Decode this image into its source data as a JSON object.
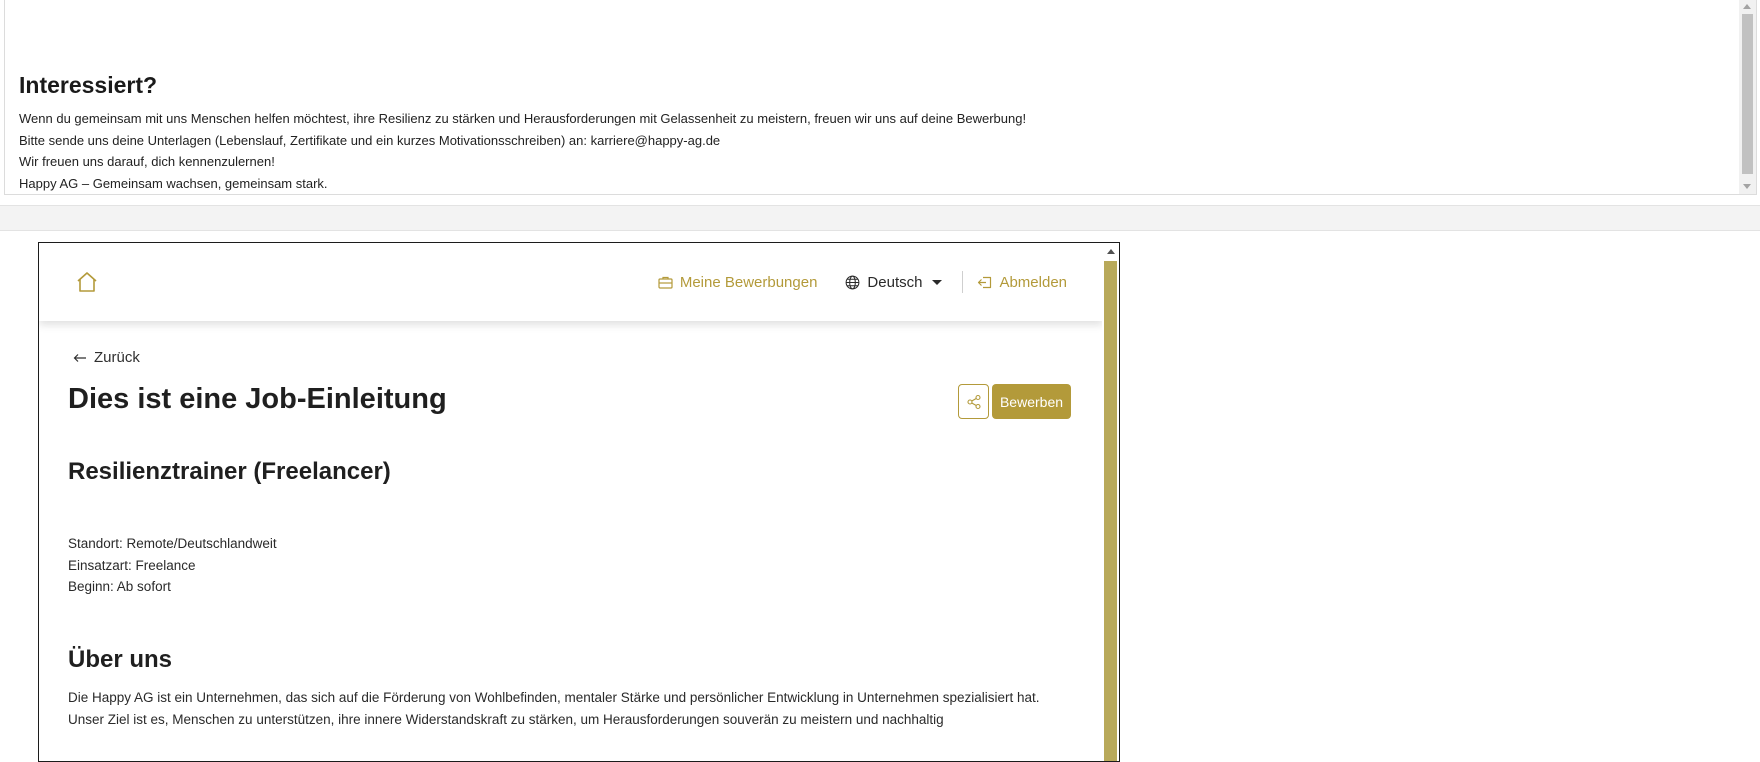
{
  "top": {
    "heading": "Interessiert?",
    "lines": [
      "Wenn du gemeinsam mit uns Menschen helfen möchtest, ihre Resilienz zu stärken und Herausforderungen mit Gelassenheit zu meistern, freuen wir uns auf deine Bewerbung!",
      "Bitte sende uns deine Unterlagen (Lebenslauf, Zertifikate und ein kurzes Motivationsschreiben) an: karriere@happy-ag.de",
      "Wir freuen uns darauf, dich kennenzulernen!",
      "Happy AG – Gemeinsam wachsen, gemeinsam stark."
    ]
  },
  "nav": {
    "home_icon": "home-icon",
    "applications": "Meine Bewerbungen",
    "language": "Deutsch",
    "logout": "Abmelden"
  },
  "page": {
    "back": "Zurück",
    "title": "Dies ist eine Job-Einleitung",
    "apply": "Bewerben",
    "share_icon": "share-icon",
    "subtitle": "Resilienztrainer (Freelancer)",
    "meta": [
      "Standort: Remote/Deutschlandweit",
      "Einsatzart: Freelance",
      "Beginn: Ab sofort"
    ],
    "about_title": "Über uns",
    "about_text": "Die Happy AG ist ein Unternehmen, das sich auf die Förderung von Wohlbefinden, mentaler Stärke und persönlicher Entwicklung in Unternehmen spezialisiert hat. Unser Ziel ist es, Menschen zu unterstützen, ihre innere Widerstandskraft zu stärken, um Herausforderungen souverän zu meistern und nachhaltig"
  },
  "colors": {
    "accent": "#b39a3a",
    "text": "#222222",
    "band": "#f3f3f3"
  }
}
